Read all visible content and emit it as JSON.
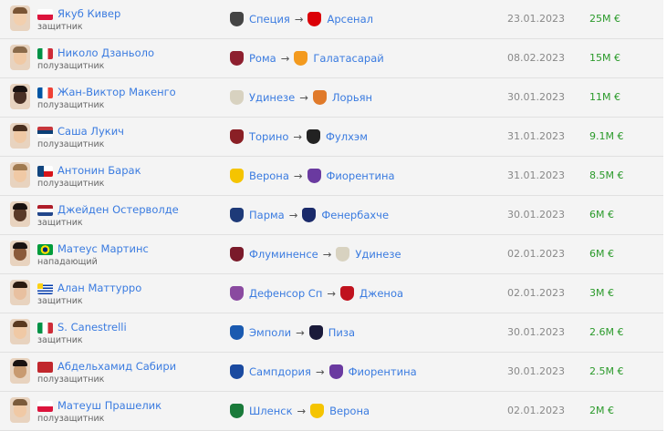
{
  "transfers": [
    {
      "name": "Якуб Кивер",
      "position": "защитник",
      "flag": [
        "#ffffff",
        "#dc143c"
      ],
      "flag_type": "h2",
      "from": "Специя",
      "from_color": "#444444",
      "to": "Арсенал",
      "to_color": "#db0007",
      "date": "23.01.2023",
      "fee": "25M €",
      "skin": "#f2cfae",
      "hair": "#7a5535"
    },
    {
      "name": "Николо Дзаньоло",
      "position": "полузащитник",
      "flag": [
        "#009246",
        "#ffffff",
        "#ce2b37"
      ],
      "flag_type": "v3",
      "from": "Рома",
      "from_color": "#8e1f2f",
      "to": "Галатасарай",
      "to_color": "#f39a1e",
      "date": "08.02.2023",
      "fee": "15M €",
      "skin": "#f0c9a5",
      "hair": "#8a6a4a"
    },
    {
      "name": "Жан-Виктор Макенго",
      "position": "полузащитник",
      "flag": [
        "#0055a4",
        "#ffffff",
        "#ef4135"
      ],
      "flag_type": "v3",
      "from": "Удинезе",
      "from_color": "#d8d2c0",
      "to": "Лорьян",
      "to_color": "#e07a2a",
      "date": "30.01.2023",
      "fee": "11M €",
      "skin": "#4a3024",
      "hair": "#1a1210"
    },
    {
      "name": "Саша Лукич",
      "position": "полузащитник",
      "flag": [
        "#c6363c",
        "#0c4076",
        "#ffffff"
      ],
      "flag_type": "h3",
      "from": "Торино",
      "from_color": "#8a1f25",
      "to": "Фулхэм",
      "to_color": "#222222",
      "date": "31.01.2023",
      "fee": "9.1M €",
      "skin": "#f0c9a5",
      "hair": "#4a3020"
    },
    {
      "name": "Антонин Барак",
      "position": "полузащитник",
      "flag": [
        "#ffffff",
        "#d7141a",
        "#11457e"
      ],
      "flag_type": "cz",
      "from": "Верона",
      "from_color": "#f5c400",
      "to": "Фиорентина",
      "to_color": "#6a3aa0",
      "date": "31.01.2023",
      "fee": "8.5M €",
      "skin": "#f0c9a5",
      "hair": "#a07a50"
    },
    {
      "name": "Джейден Остерволде",
      "position": "защитник",
      "flag": [
        "#ae1c28",
        "#ffffff",
        "#21468b"
      ],
      "flag_type": "h3",
      "from": "Парма",
      "from_color": "#1e3a78",
      "to": "Фенербахче",
      "to_color": "#1a2a6a",
      "date": "30.01.2023",
      "fee": "6M €",
      "skin": "#5a3a28",
      "hair": "#1a1210"
    },
    {
      "name": "Матеус Мартинс",
      "position": "нападающий",
      "flag": [
        "#009c3b",
        "#ffdf00",
        "#002776"
      ],
      "flag_type": "br",
      "from": "Флуминенсе",
      "from_color": "#7a1a2a",
      "to": "Удинезе",
      "to_color": "#d8d2c0",
      "date": "02.01.2023",
      "fee": "6M €",
      "skin": "#8a5a3a",
      "hair": "#1a1210"
    },
    {
      "name": "Алан Маттурро",
      "position": "защитник",
      "flag": [
        "#ffffff",
        "#0038a8",
        "#fcd116"
      ],
      "flag_type": "uy",
      "from": "Дефенсор Сп",
      "from_color": "#8a4aa0",
      "to": "Дженоа",
      "to_color": "#c0121e",
      "date": "02.01.2023",
      "fee": "3M €",
      "skin": "#e8c0a0",
      "hair": "#2a1a10"
    },
    {
      "name": "S. Canestrelli",
      "position": "защитник",
      "flag": [
        "#009246",
        "#ffffff",
        "#ce2b37"
      ],
      "flag_type": "v3",
      "from": "Эмполи",
      "from_color": "#1a5ab0",
      "to": "Пиза",
      "to_color": "#1a1a3a",
      "date": "30.01.2023",
      "fee": "2.6M €",
      "skin": "#f0c9a5",
      "hair": "#5a3a20"
    },
    {
      "name": "Абдельхамид Сабири",
      "position": "полузащитник",
      "flag": [
        "#c1272d",
        "#006233"
      ],
      "flag_type": "ma",
      "from": "Сампдория",
      "from_color": "#1a4aa0",
      "to": "Фиорентина",
      "to_color": "#6a3aa0",
      "date": "30.01.2023",
      "fee": "2.5M €",
      "skin": "#c89a70",
      "hair": "#1a1210"
    },
    {
      "name": "Матеуш Прашелик",
      "position": "полузащитник",
      "flag": [
        "#ffffff",
        "#dc143c"
      ],
      "flag_type": "h2",
      "from": "Шленск",
      "from_color": "#1a7a3a",
      "to": "Верона",
      "to_color": "#f5c400",
      "date": "02.01.2023",
      "fee": "2M €",
      "skin": "#f0c9a5",
      "hair": "#7a5a3a"
    }
  ]
}
